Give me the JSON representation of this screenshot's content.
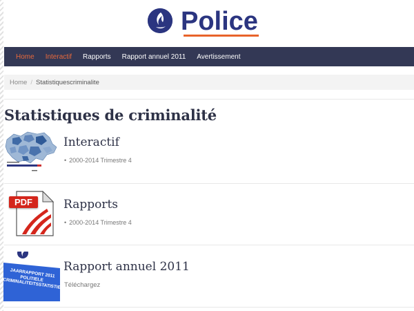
{
  "header": {
    "logo_text": "Police",
    "accent_color": "#e8632a",
    "brand_color": "#2b3580"
  },
  "nav": {
    "items": [
      {
        "label": "Home",
        "active": true
      },
      {
        "label": "Interactif",
        "active": true
      },
      {
        "label": "Rapports",
        "active": false
      },
      {
        "label": "Rapport annuel 2011",
        "active": false
      },
      {
        "label": "Avertissement",
        "active": false
      }
    ],
    "bg_color": "#333855",
    "active_color": "#e8693c"
  },
  "breadcrumb": {
    "home": "Home",
    "separator": "/",
    "current": "Statistiquescriminalite"
  },
  "page": {
    "title": "Statistiques de criminalité"
  },
  "items": [
    {
      "title": "Interactif",
      "subtitle": "2000-2014 Trimestre 4",
      "icon": "belgium-map-thumbnail"
    },
    {
      "title": "Rapports",
      "subtitle": "2000-2014 Trimestre 4",
      "icon": "pdf-icon",
      "icon_label": "PDF"
    },
    {
      "title": "Rapport annuel 2011",
      "subtitle": "Téléchargez",
      "icon": "annual-report-cover",
      "cover_lines": [
        "JAARRAPPORT 2011",
        "POLITIELE",
        "CRIMINALITEITSSTATISTIEKEN"
      ]
    }
  ]
}
